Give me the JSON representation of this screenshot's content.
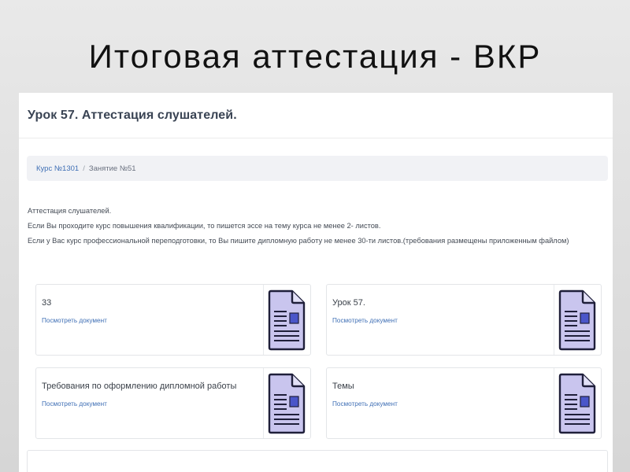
{
  "slide": {
    "title": "Итоговая аттестация - ВКР"
  },
  "page": {
    "heading": "Урок 57. Аттестация слушателей."
  },
  "breadcrumb": {
    "course": "Курс №1301",
    "separator": "/",
    "lesson": "Занятие №51"
  },
  "description": {
    "lines": [
      "Аттестация слушателей.",
      "Если Вы проходите курс повышения квалификации, то пишется эссе на тему курса не менее 2- листов.",
      "Если у Вас курс профессиональной переподготовки, то Вы пишите дипломную работу не менее 30-ти листов.(требования размещены приложенным файлом)"
    ]
  },
  "documents": [
    {
      "title": "33",
      "link": "Посмотреть документ",
      "icon": "document-icon"
    },
    {
      "title": "Урок 57.",
      "link": "Посмотреть документ",
      "icon": "document-icon"
    },
    {
      "title": "Требования по оформлению дипломной работы",
      "link": "Посмотреть документ",
      "icon": "document-icon"
    },
    {
      "title": "Темы",
      "link": "Посмотреть документ",
      "icon": "document-icon"
    }
  ],
  "colors": {
    "link": "#3f6fb5",
    "icon_fill": "#c9c5ee",
    "icon_stroke": "#1f1f3a",
    "icon_accent": "#4a56c9"
  }
}
